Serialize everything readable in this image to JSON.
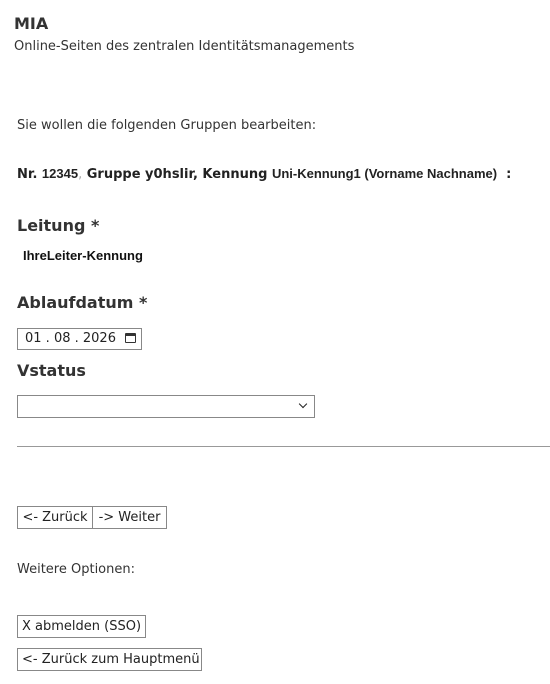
{
  "header": {
    "title": "MIA",
    "subtitle": "Online-Seiten des zentralen Identitätsmanagements"
  },
  "intro": "Sie wollen die folgenden Gruppen bearbeiten:",
  "group": {
    "nr_prefix": "Nr.",
    "nr_value": "12345",
    "separator": ",",
    "group_text": "Gruppe y0hslir, Kennung",
    "kennung_value": "Uni-Kennung1 (Vorname Nachname)",
    "suffix": ":"
  },
  "fields": {
    "leitung_label": "Leitung *",
    "leitung_value": "IhreLeiter-Kennung",
    "ablaufdatum_label": "Ablaufdatum *",
    "ablaufdatum_value": "01 . 08 . 2026",
    "vstatus_label": "Vstatus",
    "vstatus_value": ""
  },
  "nav": {
    "back_label": "<- Zurück",
    "next_label": "-> Weiter"
  },
  "more_options": {
    "heading": "Weitere Optionen:",
    "logout_label": "X abmelden (SSO)",
    "main_menu_label": "<- Zurück zum Hauptmenü"
  }
}
